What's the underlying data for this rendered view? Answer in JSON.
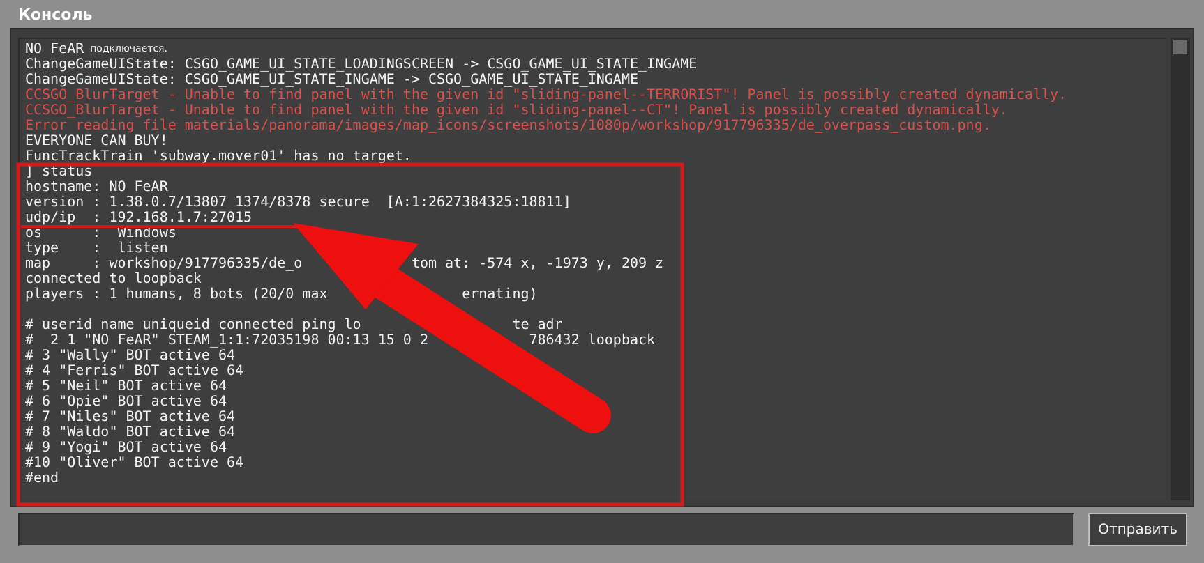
{
  "window": {
    "title": "Консоль"
  },
  "console": {
    "lines": [
      {
        "kind": "info",
        "segments": [
          {
            "kind": "text",
            "text": "NO FeAR"
          },
          {
            "kind": "small",
            "text": "подключается."
          }
        ]
      },
      {
        "kind": "info",
        "segments": [
          {
            "kind": "text",
            "text": "ChangeGameUIState: CSGO_GAME_UI_STATE_LOADINGSCREEN -> CSGO_GAME_UI_STATE_INGAME"
          }
        ]
      },
      {
        "kind": "info",
        "segments": [
          {
            "kind": "text",
            "text": "ChangeGameUIState: CSGO_GAME_UI_STATE_INGAME -> CSGO_GAME_UI_STATE_INGAME"
          }
        ]
      },
      {
        "kind": "error",
        "segments": [
          {
            "kind": "text",
            "text": "CCSGO_BlurTarget - Unable to find panel with the given id \"sliding-panel--TERRORIST\"! Panel is possibly created dynamically."
          }
        ]
      },
      {
        "kind": "error",
        "segments": [
          {
            "kind": "text",
            "text": "CCSGO_BlurTarget - Unable to find panel with the given id \"sliding-panel--CT\"! Panel is possibly created dynamically."
          }
        ]
      },
      {
        "kind": "error",
        "segments": [
          {
            "kind": "text",
            "text": "Error reading file materials/panorama/images/map_icons/screenshots/1080p/workshop/917796335/de_overpass_custom.png."
          }
        ]
      },
      {
        "kind": "info",
        "segments": [
          {
            "kind": "text",
            "text": "EVERYONE CAN BUY!"
          }
        ]
      },
      {
        "kind": "info",
        "segments": [
          {
            "kind": "text",
            "text": "FuncTrackTrain 'subway.mover01' has no target."
          }
        ]
      },
      {
        "kind": "info",
        "segments": [
          {
            "kind": "text",
            "text": "] status"
          }
        ]
      },
      {
        "kind": "info",
        "segments": [
          {
            "kind": "text",
            "text": "hostname: NO FeAR"
          }
        ]
      },
      {
        "kind": "info",
        "segments": [
          {
            "kind": "text",
            "text": "version : 1.38.0.7/13807 1374/8378 secure  [A:1:2627384325:18811]"
          }
        ]
      },
      {
        "kind": "info",
        "segments": [
          {
            "kind": "text",
            "text": "udp/ip  : 192.168.1.7:27015"
          }
        ]
      },
      {
        "kind": "info",
        "segments": [
          {
            "kind": "text",
            "text": "os      :  Windows"
          }
        ]
      },
      {
        "kind": "info",
        "segments": [
          {
            "kind": "text",
            "text": "type    :  listen"
          }
        ]
      },
      {
        "kind": "info",
        "segments": [
          {
            "kind": "text",
            "text": "map     : workshop/917796335/de_o"
          },
          {
            "kind": "text",
            "text": "tom at: -574 x, -1973 y, 209 z"
          }
        ]
      },
      {
        "kind": "info",
        "segments": [
          {
            "kind": "text",
            "text": "connected to loopback"
          }
        ]
      },
      {
        "kind": "info",
        "segments": [
          {
            "kind": "text",
            "text": "players : 1 humans, 8 bots (20/0 max"
          },
          {
            "kind": "text",
            "text": "ernating)"
          }
        ]
      },
      {
        "kind": "blank"
      },
      {
        "kind": "info",
        "segments": [
          {
            "kind": "text",
            "text": "# userid name uniqueid connected ping lo"
          },
          {
            "kind": "text",
            "text": "te adr"
          }
        ]
      },
      {
        "kind": "info",
        "segments": [
          {
            "kind": "text",
            "text": "#  2 1 \"NO FeAR\" STEAM_1:1:72035198 00:13"
          },
          {
            "kind": "text",
            "text": "15 0 2"
          },
          {
            "kind": "text",
            "text": "786432 loopback"
          }
        ]
      },
      {
        "kind": "info",
        "segments": [
          {
            "kind": "text",
            "text": "# 3 \"Wally\" BOT active 64"
          }
        ]
      },
      {
        "kind": "info",
        "segments": [
          {
            "kind": "text",
            "text": "# 4 \"Ferris\" BOT active 64"
          }
        ]
      },
      {
        "kind": "info",
        "segments": [
          {
            "kind": "text",
            "text": "# 5 \"Neil\" BOT active 64"
          }
        ]
      },
      {
        "kind": "info",
        "segments": [
          {
            "kind": "text",
            "text": "# 6 \"Opie\" BOT active 64"
          }
        ]
      },
      {
        "kind": "info",
        "segments": [
          {
            "kind": "text",
            "text": "# 7 \"Niles\" BOT active 64"
          }
        ]
      },
      {
        "kind": "info",
        "segments": [
          {
            "kind": "text",
            "text": "# 8 \"Waldo\" BOT active 64"
          }
        ]
      },
      {
        "kind": "info",
        "segments": [
          {
            "kind": "text",
            "text": "# 9 \"Yogi\" BOT active 64"
          }
        ]
      },
      {
        "kind": "info",
        "segments": [
          {
            "kind": "text",
            "text": "#10 \"Oliver\" BOT active 64"
          }
        ]
      },
      {
        "kind": "info",
        "segments": [
          {
            "kind": "text",
            "text": "#end"
          }
        ]
      }
    ]
  },
  "input": {
    "send_button": "Отправить"
  }
}
